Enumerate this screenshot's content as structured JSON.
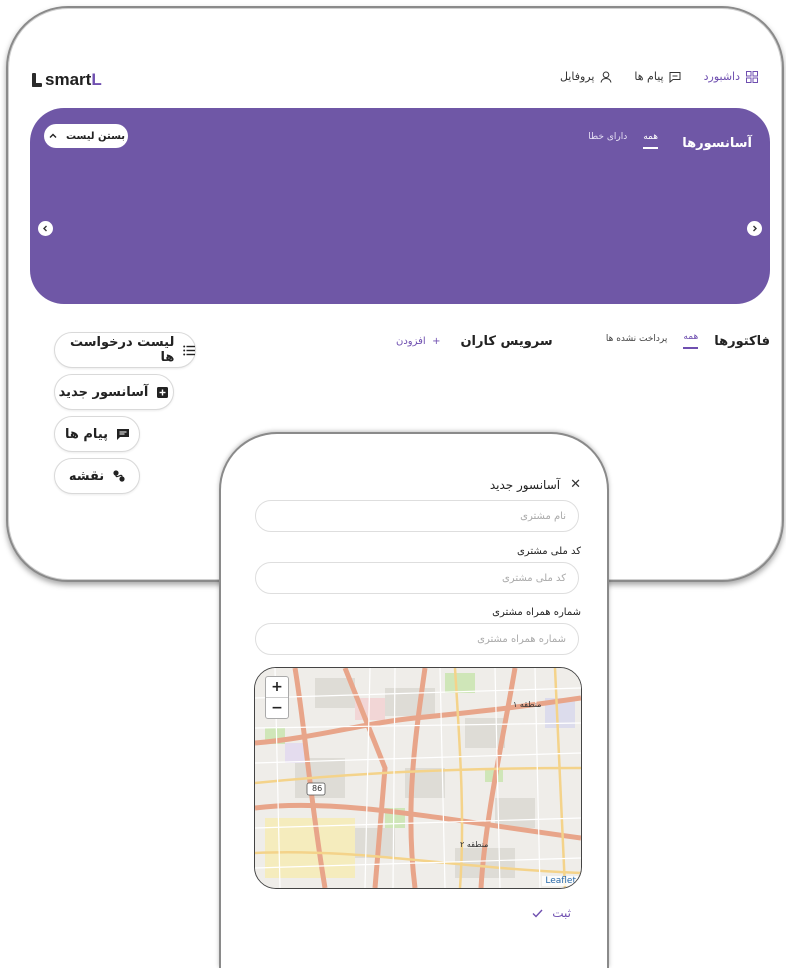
{
  "app": {
    "logo_main": "smart",
    "logo_accent": "L"
  },
  "topnav": {
    "dashboard": "داشبورد",
    "messages": "پیام ها",
    "profile": "پروفایل"
  },
  "elevators": {
    "title": "آسانسورها",
    "tabs": [
      "همه",
      "دارای خطا"
    ],
    "collapse_label": "بستن لیست"
  },
  "invoices": {
    "title": "فاکتورها",
    "tabs": [
      "همه",
      "پرداخت نشده ها"
    ]
  },
  "service": {
    "title": "سرویس کاران",
    "add_label": "افزودن"
  },
  "side_actions": {
    "request_list": "لیست درخواست ها",
    "new_elevator": "آسانسور جدید",
    "messages": "پیام ها",
    "map": "نقشه"
  },
  "form": {
    "title": "آسانسور جدید",
    "customer_name_placeholder": "نام مشتری",
    "national_code_label": "کد ملی مشتری",
    "national_code_placeholder": "کد ملی مشتری",
    "phone_label": "شماره همراه مشتری",
    "phone_placeholder": "شماره همراه مشتری",
    "submit_label": "ثبت"
  },
  "map": {
    "zoom_in": "+",
    "zoom_out": "−",
    "attribution": "Leaflet",
    "region1": "منطقه ۱",
    "region2": "منطقه ۲",
    "road_shield": "86"
  },
  "colors": {
    "accent": "#6f4fb0",
    "hero": "#6f57a6"
  }
}
